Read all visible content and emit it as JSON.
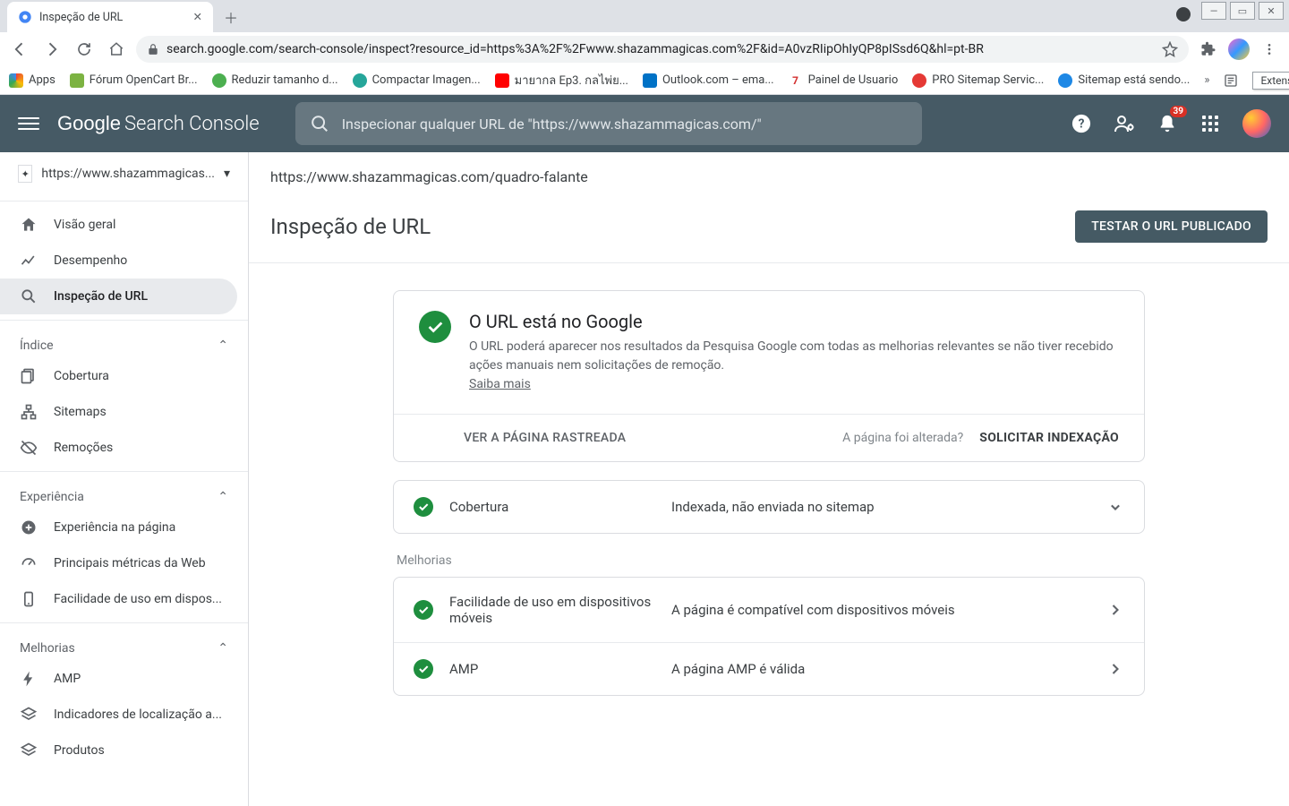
{
  "browser": {
    "tab_title": "Inspeção de URL",
    "url": "search.google.com/search-console/inspect?resource_id=https%3A%2F%2Fwww.shazammagicas.com%2F&id=A0vzRIipOhIyQP8pISsd6Q&hl=pt-BR",
    "extensions_label": "Extensões",
    "bookmarks": [
      {
        "label": "Apps",
        "color": "#ea4335"
      },
      {
        "label": "Fórum OpenCart Br...",
        "color": "#7cb342"
      },
      {
        "label": "Reduzir tamanho d...",
        "color": "#4caf50"
      },
      {
        "label": "Compactar Imagen...",
        "color": "#26a69a"
      },
      {
        "label": "มายากล Ep3. กลไพ่ย...",
        "color": "#ff0000"
      },
      {
        "label": "Outlook.com – ema...",
        "color": "#0072c6"
      },
      {
        "label": "Painel de Usuario",
        "color": "#d32f2f"
      },
      {
        "label": "PRO Sitemap Servic...",
        "color": "#e53935"
      },
      {
        "label": "Sitemap está sendo...",
        "color": "#1e88e5"
      }
    ]
  },
  "header": {
    "logo_google": "Google",
    "logo_sc": "Search Console",
    "search_placeholder": "Inspecionar qualquer URL de \"https://www.shazammagicas.com/\"",
    "notification_count": "39"
  },
  "sidebar": {
    "property": "https://www.shazammagicas...",
    "items_top": [
      {
        "label": "Visão geral"
      },
      {
        "label": "Desempenho"
      },
      {
        "label": "Inspeção de URL",
        "active": true
      }
    ],
    "section_index": "Índice",
    "items_index": [
      {
        "label": "Cobertura"
      },
      {
        "label": "Sitemaps"
      },
      {
        "label": "Remoções"
      }
    ],
    "section_experience": "Experiência",
    "items_experience": [
      {
        "label": "Experiência na página"
      },
      {
        "label": "Principais métricas da Web"
      },
      {
        "label": "Facilidade de uso em dispos..."
      }
    ],
    "section_enhancements": "Melhorias",
    "items_enhancements": [
      {
        "label": "AMP"
      },
      {
        "label": "Indicadores de localização a..."
      },
      {
        "label": "Produtos"
      }
    ]
  },
  "main": {
    "inspected_url": "https://www.shazammagicas.com/quadro-falante",
    "page_title": "Inspeção de URL",
    "test_button": "TESTAR O URL PUBLICADO",
    "status_title": "O URL está no Google",
    "status_desc": "O URL poderá aparecer nos resultados da Pesquisa Google com todas as melhorias relevantes se não tiver recebido ações manuais nem solicitações de remoção.",
    "learn_more": "Saiba mais",
    "view_crawled": "VER A PÁGINA RASTREADA",
    "page_changed": "A página foi alterada?",
    "request_indexing": "SOLICITAR INDEXAÇÃO",
    "coverage_label": "Cobertura",
    "coverage_value": "Indexada, não enviada no sitemap",
    "enhancements_label": "Melhorias",
    "mobile_label": "Facilidade de uso em dispositivos móveis",
    "mobile_value": "A página é compatível com dispositivos móveis",
    "amp_label": "AMP",
    "amp_value": "A página AMP é válida"
  }
}
